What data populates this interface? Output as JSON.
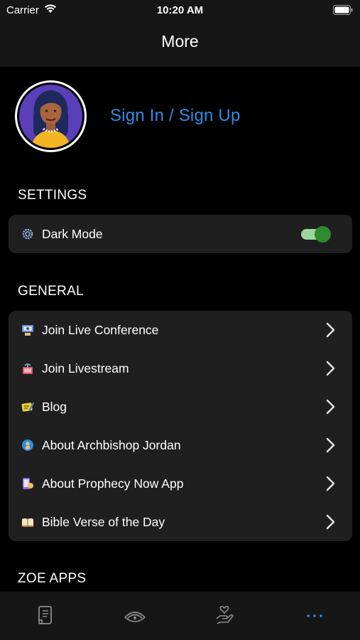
{
  "status_bar": {
    "carrier": "Carrier",
    "time": "10:20 AM"
  },
  "nav": {
    "title": "More"
  },
  "profile": {
    "signin_label": "Sign In / Sign Up"
  },
  "settings": {
    "header": "SETTINGS",
    "dark_mode": {
      "label": "Dark Mode",
      "enabled": true,
      "icon": "gear-icon"
    }
  },
  "general": {
    "header": "GENERAL",
    "items": [
      {
        "label": "Join Live Conference",
        "icon": "conference-icon"
      },
      {
        "label": "Join Livestream",
        "icon": "livestream-icon"
      },
      {
        "label": "Blog",
        "icon": "blog-icon"
      },
      {
        "label": "About Archbishop Jordan",
        "icon": "info-icon"
      },
      {
        "label": "About Prophecy Now App",
        "icon": "app-info-icon"
      },
      {
        "label": "Bible Verse of the Day",
        "icon": "bible-icon"
      }
    ]
  },
  "zoe_apps": {
    "header": "ZOE APPS"
  },
  "tabs": [
    {
      "icon": "scroll-icon",
      "active": false
    },
    {
      "icon": "broadcast-icon",
      "active": false
    },
    {
      "icon": "giving-hand-icon",
      "active": false
    },
    {
      "icon": "more-icon",
      "active": true
    }
  ],
  "colors": {
    "accent": "#2f8ce6",
    "toggle_on": "#2e8b2e",
    "card": "#1f1f1f",
    "bar": "#161616"
  }
}
